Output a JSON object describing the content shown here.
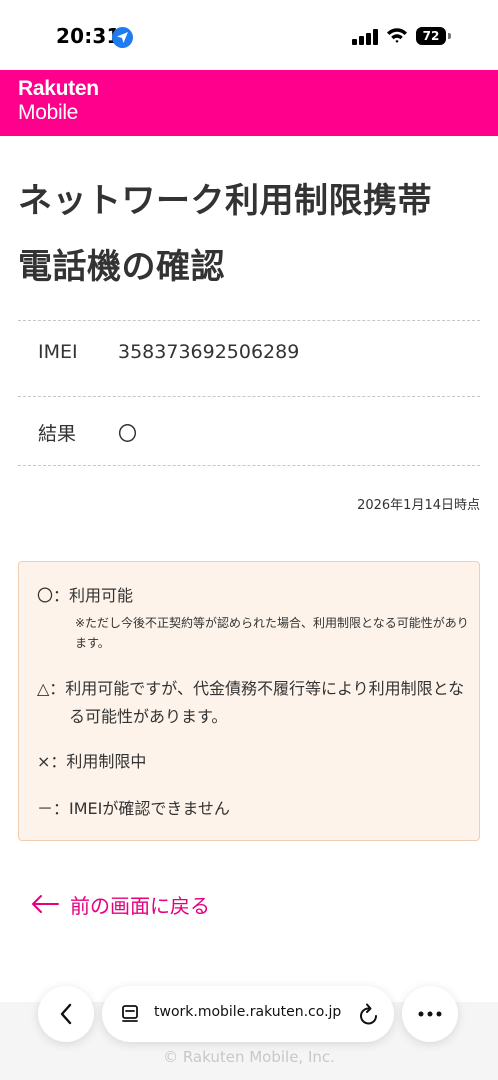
{
  "status_bar": {
    "time": "20:31",
    "battery": "72"
  },
  "header": {
    "logo_line1": "Rakuten",
    "logo_line2": "Mobile"
  },
  "main": {
    "title_line1": "ネットワーク利用制限携帯",
    "title_line2": "電話機の確認",
    "rows": [
      {
        "label": "IMEI",
        "value": "358373692506289"
      },
      {
        "label": "結果",
        "value": "〇"
      }
    ],
    "checked_date": "2026年1月14日時点"
  },
  "legend": {
    "available": "〇：利用可能",
    "available_note": "※ただし今後不正契約等が認められた場合、利用制限となる可能性があります。",
    "warning": "△：利用可能ですが、代金債務不履行等により利用制限となる可能性があります。",
    "restricted": "×：利用制限中",
    "unknown": "－：IMEIが確認できません"
  },
  "back_link": {
    "label": "前の画面に戻る"
  },
  "browser": {
    "url": "twork.mobile.rakuten.co.jp"
  },
  "footer": {
    "copyright": "© Rakuten Mobile, Inc."
  },
  "colors": {
    "brand": "#ff008c",
    "link": "#e6007e",
    "legend_bg": "#fdf3ea",
    "legend_border": "#f3cdb0"
  },
  "icons": {
    "location": "location-arrow-icon",
    "signal": "cellular-signal-icon",
    "wifi": "wifi-icon",
    "battery": "battery-icon",
    "back_arrow": "arrow-left-icon",
    "browser_back": "chevron-left-icon",
    "page": "page-icon",
    "reload": "reload-icon",
    "more": "more-dots-icon"
  }
}
